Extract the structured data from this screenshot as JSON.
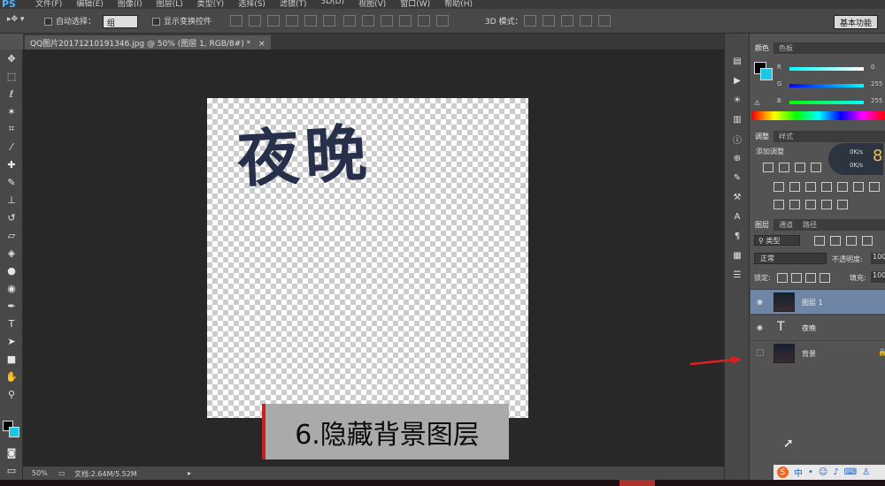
{
  "app": {
    "logo": "PS"
  },
  "menu": [
    "文件(F)",
    "编辑(E)",
    "图像(I)",
    "图层(L)",
    "类型(Y)",
    "选择(S)",
    "滤镜(T)",
    "3D(D)",
    "视图(V)",
    "窗口(W)",
    "帮助(H)"
  ],
  "options": {
    "auto_select_label": "自动选择：",
    "auto_select_value": "组",
    "show_transform_label": "显示变换控件",
    "mode_3d_label": "3D 模式：",
    "workspace": "基本功能"
  },
  "document": {
    "tab_title": "QQ图片20171210191346.jpg @ 50% (图层 1, RGB/8#) *",
    "canvas_text": "夜晚"
  },
  "caption": "6.隐藏背景图层",
  "status": {
    "zoom": "50%",
    "doc_size": "文档:2.64M/5.52M"
  },
  "panels": {
    "color_tabs": [
      "颜色",
      "色板"
    ],
    "color": {
      "r_label": "R",
      "g_label": "G",
      "b_label": "B",
      "r": "0",
      "g": "255",
      "b": "255"
    },
    "adjust_tabs": [
      "调整",
      "样式"
    ],
    "adjust_label": "添加调整",
    "net_up": "0K/s",
    "net_down": "0K/s",
    "net_badge": "8",
    "layers_tabs": [
      "图层",
      "通道",
      "路径"
    ],
    "filter_kind": "类型",
    "blend_mode": "正常",
    "opacity_label": "不透明度:",
    "opacity_value": "100",
    "lock_label": "锁定:",
    "fill_label": "填充:",
    "fill_value": "100",
    "layers": [
      {
        "name": "图层 1",
        "visible": true,
        "selected": true,
        "type": "image"
      },
      {
        "name": "夜晚",
        "visible": true,
        "selected": false,
        "type": "text"
      },
      {
        "name": "背景",
        "visible": false,
        "selected": false,
        "type": "image"
      }
    ]
  },
  "ime": {
    "lang": "中"
  },
  "colors": {
    "foreground": "#000000",
    "background": "#1ac8e6",
    "caption_bar": "#c62020",
    "arrow": "#e02020"
  }
}
